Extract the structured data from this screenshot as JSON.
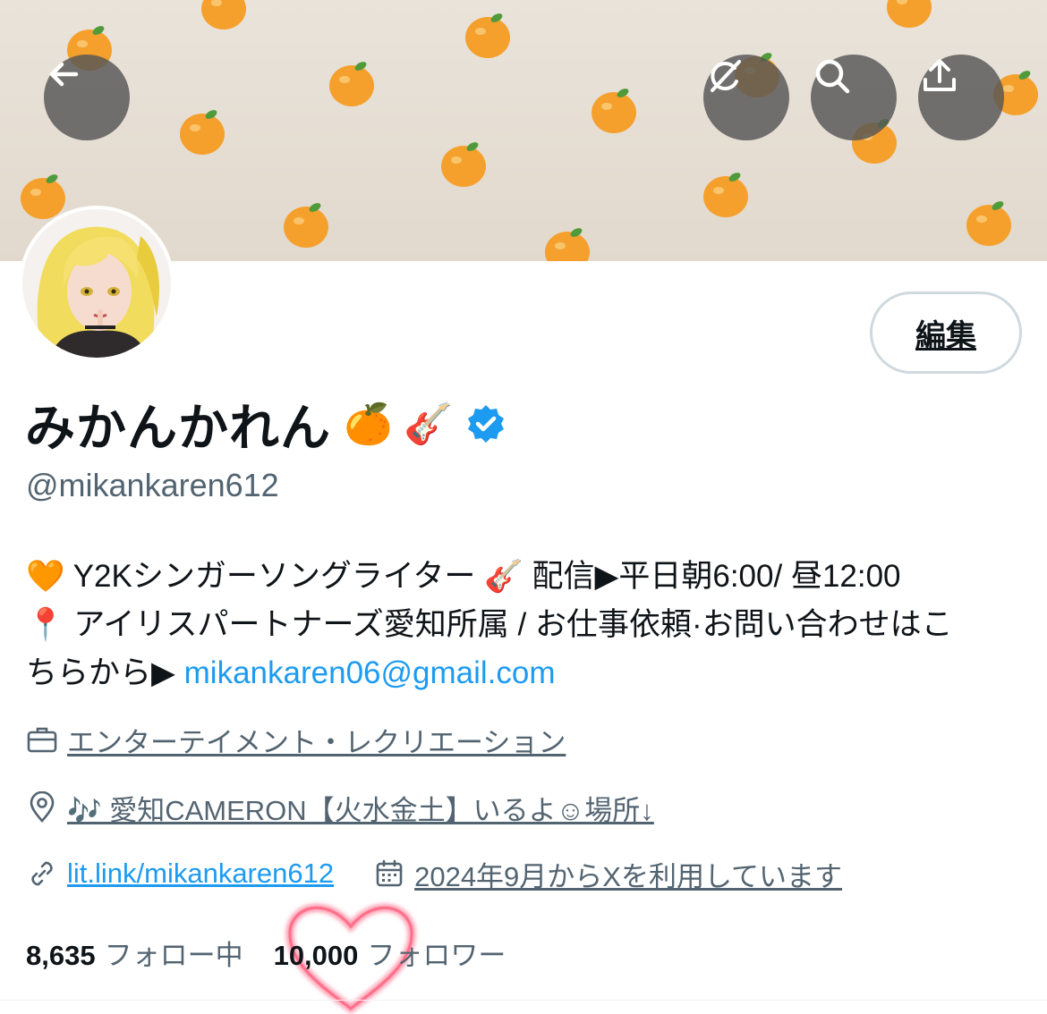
{
  "header": {
    "back_icon": "arrow-left-icon",
    "grok_icon": "grok-icon",
    "search_icon": "search-icon",
    "share_icon": "share-upload-icon"
  },
  "profile": {
    "display_name": "みかんかれん",
    "name_emojis": "🍊 🎸",
    "handle": "@mikankaren612",
    "edit_label": "編集",
    "bio_line1": "🧡 Y2Kシンガーソングライター 🎸 配信▶平日朝6:00/ 昼12:00",
    "bio_line2": "📍 アイリスパートナーズ愛知所属 / お仕事依頼·お問い合わせはこ",
    "bio_line3_prefix": "ちらから▶ ",
    "bio_email": "mikankaren06@gmail.com",
    "category": "エンターテイメント・レクリエーション",
    "location": "🎶 愛知CAMERON【火水金土】いるよ☺場所↓",
    "website": "lit.link/mikankaren612",
    "joined": "2024年9月からXを利用しています",
    "following_count": "8,635",
    "following_label": "フォロー中",
    "followers_count": "10,000",
    "followers_label": "フォロワー"
  },
  "colors": {
    "accent": "#1d9bf0",
    "verified": "#1d9bf0",
    "muted_text": "#536471",
    "banner_bg": "#e6dfd5",
    "orange": "#f5a02c",
    "heart": "#ff6f8a"
  }
}
